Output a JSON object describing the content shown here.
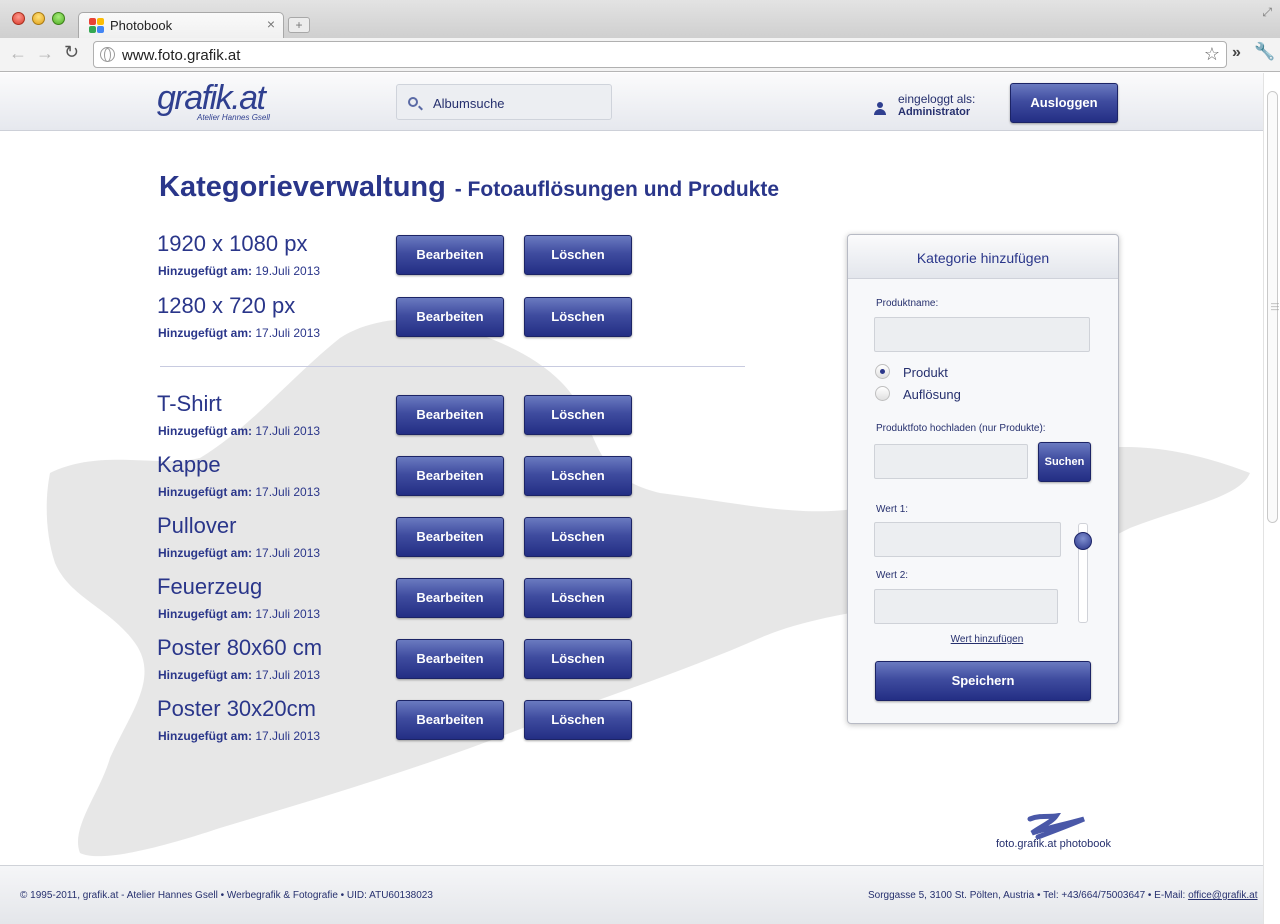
{
  "browser": {
    "tab_title": "Photobook",
    "tab_close": "×",
    "new_tab": "+",
    "url": "www.foto.grafik.at",
    "icons": [
      "back-icon",
      "forward-icon",
      "reload-icon",
      "globe-icon",
      "star-icon",
      "chevron-right-icon",
      "wrench-icon"
    ]
  },
  "header": {
    "logo_text": "grafik.at",
    "logo_sub": "Atelier Hannes Gsell",
    "search_placeholder": "Albumsuche",
    "login_label": "eingeloggt als:",
    "login_user": "Administrator",
    "logout_label": "Ausloggen"
  },
  "page": {
    "title": "Kategorieverwaltung",
    "subtitle": "- Fotoauflösungen und Produkte"
  },
  "labels": {
    "added_on": "Hinzugefügt am:",
    "edit": "Bearbeiten",
    "delete": "Löschen"
  },
  "resolutions": [
    {
      "name": "1920 x 1080 px",
      "date": "19.Juli 2013"
    },
    {
      "name": "1280 x 720 px",
      "date": "17.Juli 2013"
    }
  ],
  "products": [
    {
      "name": "T-Shirt",
      "date": "17.Juli 2013"
    },
    {
      "name": "Kappe",
      "date": "17.Juli 2013"
    },
    {
      "name": "Pullover",
      "date": "17.Juli 2013"
    },
    {
      "name": "Feuerzeug",
      "date": "17.Juli 2013"
    },
    {
      "name": "Poster 80x60 cm",
      "date": "17.Juli 2013"
    },
    {
      "name": "Poster 30x20cm",
      "date": "17.Juli 2013"
    }
  ],
  "panel": {
    "title": "Kategorie hinzufügen",
    "product_name_label": "Produktname:",
    "product_name_value": "",
    "radio_options": [
      {
        "label": "Produkt",
        "selected": true
      },
      {
        "label": "Auflösung",
        "selected": false
      }
    ],
    "upload_label": "Produktfoto hochladen (nur Produkte):",
    "search_button": "Suchen",
    "value1_label": "Wert 1:",
    "value2_label": "Wert 2:",
    "add_value_link": "Wert hinzufügen",
    "save_button": "Speichern"
  },
  "brand": {
    "text": "foto.grafik.at photobook"
  },
  "footer": {
    "left": "© 1995-2011, grafik.at - Atelier Hannes Gsell • Werbegrafik & Fotografie • UID: ATU60138023",
    "right_prefix": "Sorggasse 5, 3100 St. Pölten, Austria • Tel: +43/664/75003647 • E-Mail: ",
    "email": "office@grafik.at"
  },
  "colors": {
    "brand_blue": "#2a368a",
    "button_top": "#6a7ac0",
    "button_bottom": "#232e84"
  }
}
